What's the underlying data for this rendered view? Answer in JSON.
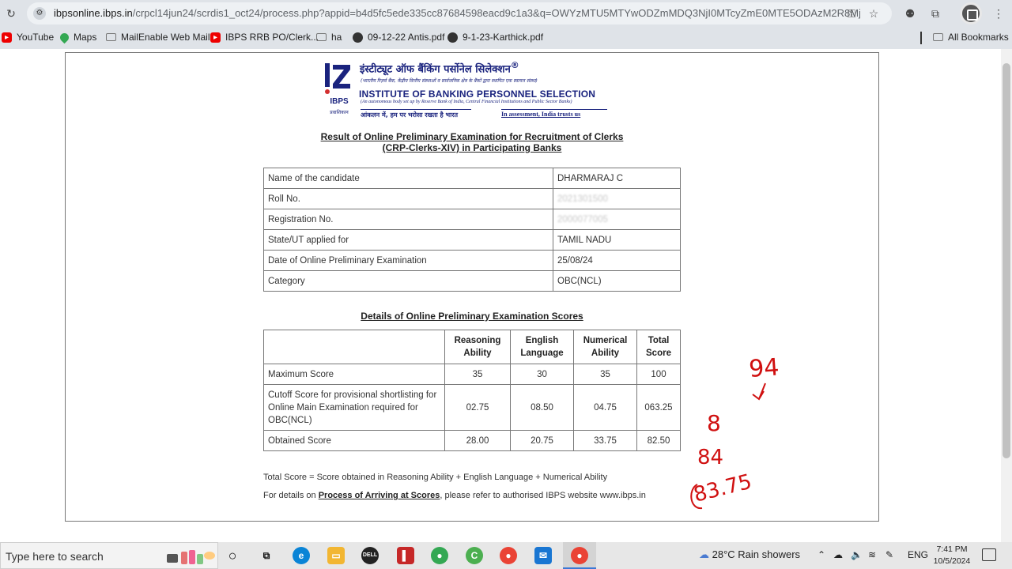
{
  "browser": {
    "url_host": "ibpsonline.ibps.in",
    "url_path": "/crpcl14jun24/scrdis1_oct24/process.php?appid=b4d5fc5ede335cc87684598eacd9c1a3&q=OWYzMTU5MTYwODZmMDQ3NjI0MTcyZmE0MTE5ODAzM2R8MjM4M..."
  },
  "bookmarks": [
    {
      "label": "YouTube",
      "icon": "youtube-icon"
    },
    {
      "label": "Maps",
      "icon": "maps-icon"
    },
    {
      "label": "MailEnable Web Mail",
      "icon": "mail-icon"
    },
    {
      "label": "IBPS RRB PO/Clerk...",
      "icon": "youtube-icon"
    },
    {
      "label": "ha",
      "icon": "mail-icon"
    },
    {
      "label": "09-12-22 Antis.pdf",
      "icon": "globe-icon"
    },
    {
      "label": "9-1-23-Karthick.pdf",
      "icon": "globe-icon"
    }
  ],
  "all_bookmarks": "All Bookmarks",
  "header": {
    "hindi_name": "इंस्टीट्यूट ऑफ बैंकिंग पर्सोनेल सिलेक्शन",
    "registered": "®",
    "hindi_sub": "(भारतीय रिज़र्व बैंक, केंद्रीय वित्तीय संस्थाओं व सार्वजनिक क्षेत्र के बैंकों द्वारा स्थापित एक स्वायत्त संस्था)",
    "english_name": "INSTITUTE OF BANKING PERSONNEL SELECTION",
    "english_sub": "(An autonomous body set up by Reserve Bank of India, Central Financial Institutions and Public Sector Banks)",
    "tagline_hindi": "आंकलन में, हम पर भरोसा रखता है भारत",
    "tagline_english": "In assessment, India trusts us",
    "logo_text": "IBPS",
    "logo_hindi": "प्रवाशिकान"
  },
  "result_title_line1": "Result of Online Preliminary Examination for Recruitment of Clerks",
  "result_title_line2": "(CRP-Clerks-XIV) in Participating Banks",
  "candidate": [
    {
      "label": "Name of the candidate",
      "value": "DHARMARAJ C"
    },
    {
      "label": "Roll No.",
      "value": "2021301500"
    },
    {
      "label": "Registration No.",
      "value": "2000077005"
    },
    {
      "label": "State/UT applied for",
      "value": "TAMIL NADU"
    },
    {
      "label": "Date of Online Preliminary Examination",
      "value": "25/08/24"
    },
    {
      "label": "Category",
      "value": "OBC(NCL)"
    }
  ],
  "scores_title": "Details of Online Preliminary Examination Scores",
  "scores": {
    "headers": [
      "",
      "Reasoning Ability",
      "English Language",
      "Numerical Ability",
      "Total Score"
    ],
    "rows": [
      {
        "label": "Maximum Score",
        "values": [
          "35",
          "30",
          "35",
          "100"
        ]
      },
      {
        "label": "Cutoff Score for provisional shortlisting for Online Main Examination required for OBC(NCL)",
        "values": [
          "02.75",
          "08.50",
          "04.75",
          "063.25"
        ]
      },
      {
        "label": "Obtained Score",
        "values": [
          "28.00",
          "20.75",
          "33.75",
          "82.50"
        ]
      }
    ]
  },
  "note1": "Total Score = Score obtained in Reasoning Ability + English Language + Numerical Ability",
  "note2_prefix": "For details on ",
  "note2_link": "Process of Arriving at Scores",
  "note2_suffix": ", please refer to authorised IBPS website www.ibps.in",
  "annotations": [
    "94",
    "8",
    "84",
    "83.75"
  ],
  "taskbar": {
    "search_placeholder": "Type here to search",
    "weather": "28°C  Rain showers",
    "lang": "ENG",
    "time": "7:41 PM",
    "date": "10/5/2024"
  }
}
